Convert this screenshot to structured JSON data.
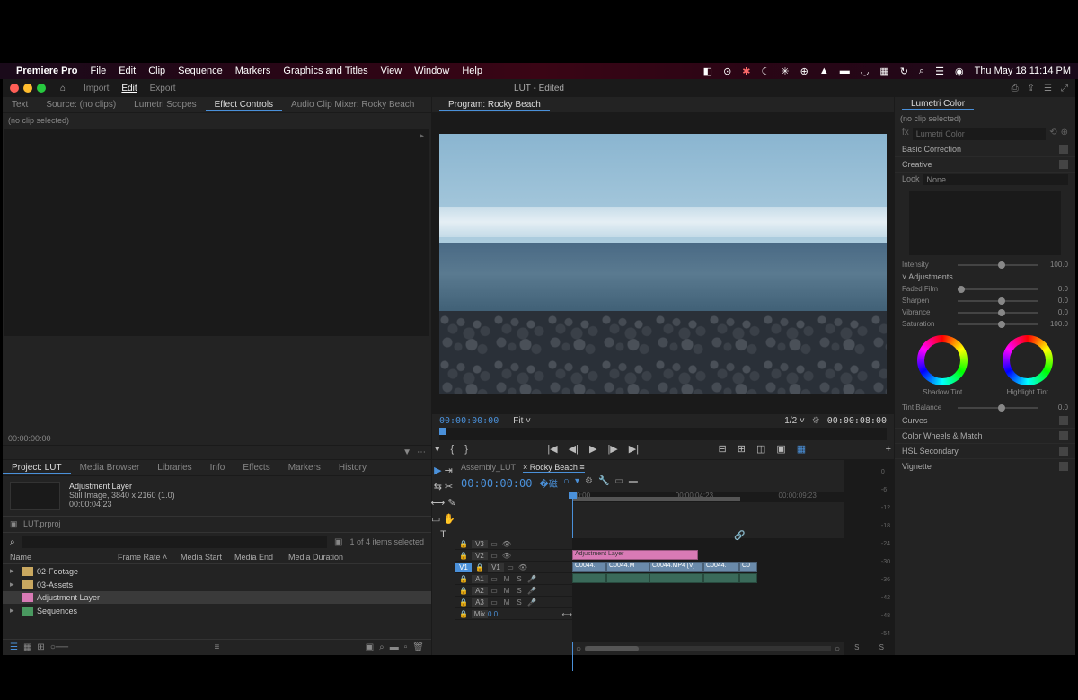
{
  "menubar": {
    "app": "Premiere Pro",
    "items": [
      "File",
      "Edit",
      "Clip",
      "Sequence",
      "Markers",
      "Graphics and Titles",
      "View",
      "Window",
      "Help"
    ],
    "datetime": "Thu May 18  11:14 PM"
  },
  "titlebar": {
    "modes": [
      "Import",
      "Edit",
      "Export"
    ],
    "active_mode": "Edit",
    "title": "LUT - Edited"
  },
  "source_tabs": [
    "Text",
    "Source: (no clips)",
    "Lumetri Scopes",
    "Effect Controls",
    "Audio Clip Mixer: Rocky Beach"
  ],
  "source_active": "Effect Controls",
  "effect_controls": {
    "noclip": "(no clip selected)",
    "tc": "00:00:00:00"
  },
  "project": {
    "tabs": [
      "Project: LUT",
      "Media Browser",
      "Libraries",
      "Info",
      "Effects",
      "Markers",
      "History"
    ],
    "active_tab": "Project: LUT",
    "selected": {
      "name": "Adjustment Layer",
      "meta1": "Still Image, 3840 x 2160 (1.0)",
      "meta2": "00:00:04:23"
    },
    "path": "LUT.prproj",
    "count": "1 of 4 items selected",
    "cols": [
      "Name",
      "Frame Rate",
      "Media Start",
      "Media End",
      "Media Duration"
    ],
    "rows": [
      {
        "name": "02-Footage",
        "type": "folder"
      },
      {
        "name": "03-Assets",
        "type": "folder"
      },
      {
        "name": "Adjustment Layer",
        "type": "adj",
        "selected": true
      },
      {
        "name": "Sequences",
        "type": "folder"
      }
    ]
  },
  "program": {
    "tab": "Program: Rocky Beach",
    "tc_left": "00:00:00:00",
    "fit": "Fit",
    "res": "1/2",
    "tc_right": "00:00:08:00"
  },
  "timeline": {
    "tabs": [
      "Assembly_LUT",
      "Rocky Beach"
    ],
    "active": "Rocky Beach",
    "tc": "00:00:00:00",
    "ruler": [
      "00:00",
      "00:00:04:23",
      "00:00:09:23"
    ],
    "video_tracks": [
      "V3",
      "V2",
      "V1"
    ],
    "audio_tracks": [
      "A1",
      "A2",
      "A3"
    ],
    "mix": "Mix",
    "mix_val": "0.0",
    "clips": {
      "adjustment": "Adjustment Layer",
      "v": [
        "C0044.",
        "C0044.M",
        "C0044.MP4 [V]",
        "C0044.",
        "C0"
      ]
    },
    "meter_marks": [
      "0",
      "-6",
      "-12",
      "-18",
      "-24",
      "-30",
      "-36",
      "-42",
      "-48",
      "-54"
    ]
  },
  "lumetri": {
    "title": "Lumetri Color",
    "noclip": "(no clip selected)",
    "effect": "Lumetri Color",
    "sections": {
      "basic": "Basic Correction",
      "creative": "Creative",
      "curves": "Curves",
      "wheels": "Color Wheels & Match",
      "hsl": "HSL Secondary",
      "vignette": "Vignette"
    },
    "look_label": "Look",
    "look_value": "None",
    "intensity": {
      "label": "Intensity",
      "val": "100.0"
    },
    "adjustments_label": "Adjustments",
    "sliders": [
      {
        "label": "Faded Film",
        "val": "0.0",
        "pos": 0
      },
      {
        "label": "Sharpen",
        "val": "0.0",
        "pos": 50
      },
      {
        "label": "Vibrance",
        "val": "0.0",
        "pos": 50
      },
      {
        "label": "Saturation",
        "val": "100.0",
        "pos": 50
      }
    ],
    "wheel_labels": [
      "Shadow Tint",
      "Highlight Tint"
    ],
    "tint": {
      "label": "Tint Balance",
      "val": "0.0"
    }
  }
}
